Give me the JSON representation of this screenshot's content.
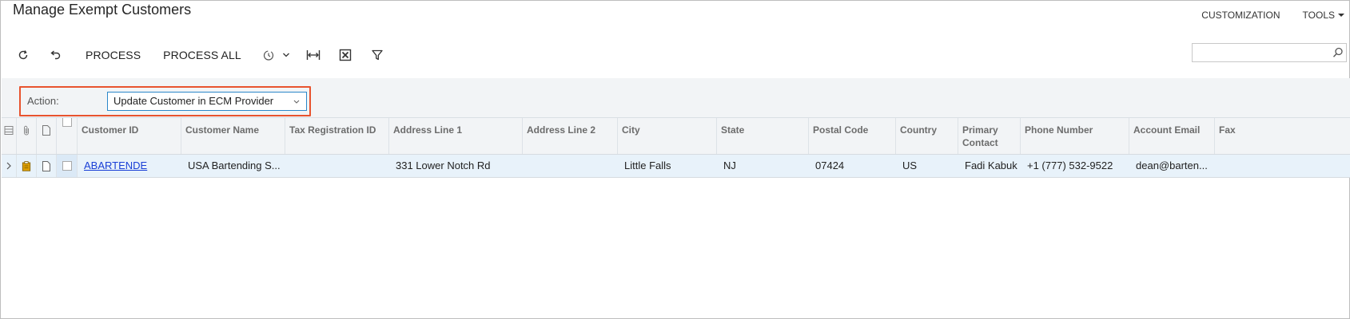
{
  "page": {
    "title": "Manage Exempt Customers"
  },
  "top_links": {
    "customization": "CUSTOMIZATION",
    "tools": "TOOLS"
  },
  "search": {
    "value": "",
    "placeholder": ""
  },
  "toolbar": {
    "process_label": "PROCESS",
    "process_all_label": "PROCESS ALL"
  },
  "filter": {
    "action_label": "Action:",
    "action_value": "Update Customer in ECM Provider"
  },
  "grid": {
    "columns": {
      "customer_id": "Customer ID",
      "customer_name": "Customer Name",
      "tax_registration_id": "Tax Registration ID",
      "address_line_1": "Address Line 1",
      "address_line_2": "Address Line 2",
      "city": "City",
      "state": "State",
      "postal_code": "Postal Code",
      "country": "Country",
      "primary_contact_line1": "Primary",
      "primary_contact_line2": "Contact",
      "phone_number": "Phone Number",
      "account_email": "Account Email",
      "fax": "Fax"
    },
    "rows": [
      {
        "customer_id": "ABARTENDE",
        "customer_name": "USA Bartending S...",
        "tax_registration_id": "",
        "address_line_1": "331 Lower Notch Rd",
        "address_line_2": "",
        "city": "Little Falls",
        "state": "NJ",
        "postal_code": "07424",
        "country": "US",
        "primary_contact": "Fadi Kabuk",
        "phone_number": "+1 (777) 532-9522",
        "account_email": "dean@barten...",
        "fax": ""
      }
    ]
  },
  "colors": {
    "accent_link": "#1a3fd6",
    "highlight_border": "#e8532e",
    "select_border": "#2b87c9",
    "row_selected": "#e8f2fa",
    "attachment_icon": "#e0a000"
  }
}
